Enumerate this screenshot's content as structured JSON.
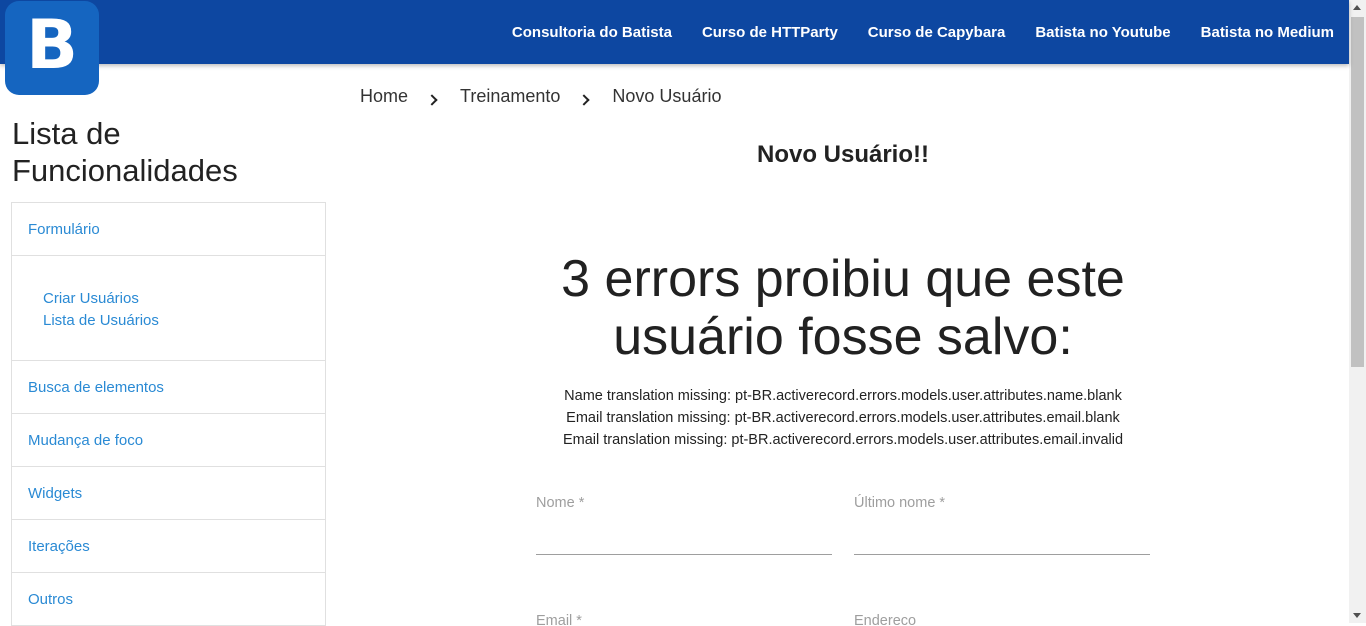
{
  "nav": {
    "logo_letter": "B",
    "links": [
      "Consultoria do Batista",
      "Curso de HTTParty",
      "Curso de Capybara",
      "Batista no Youtube",
      "Batista no Medium"
    ]
  },
  "breadcrumb": [
    "Home",
    "Treinamento",
    "Novo Usuário"
  ],
  "sidebar": {
    "title": "Lista de Funcionalidades",
    "items": [
      {
        "label": "Formulário"
      },
      {
        "label": "Busca de elementos"
      },
      {
        "label": "Mudança de foco"
      },
      {
        "label": "Widgets"
      },
      {
        "label": "Iterações"
      },
      {
        "label": "Outros"
      }
    ],
    "subitems": [
      "Criar Usuários",
      "Lista de Usuários"
    ]
  },
  "main": {
    "heading": "Novo Usuário!!",
    "error_title": "3 errors proibiu que este usuário fosse salvo:",
    "errors": [
      "Name translation missing: pt-BR.activerecord.errors.models.user.attributes.name.blank",
      "Email translation missing: pt-BR.activerecord.errors.models.user.attributes.email.blank",
      "Email translation missing: pt-BR.activerecord.errors.models.user.attributes.email.invalid"
    ],
    "form": {
      "name_label": "Nome *",
      "lastname_label": "Último nome *",
      "email_label": "Email *",
      "address_label": "Endereço"
    }
  },
  "colors": {
    "navbar": "#0d47a1",
    "link": "#2a8ad4"
  }
}
